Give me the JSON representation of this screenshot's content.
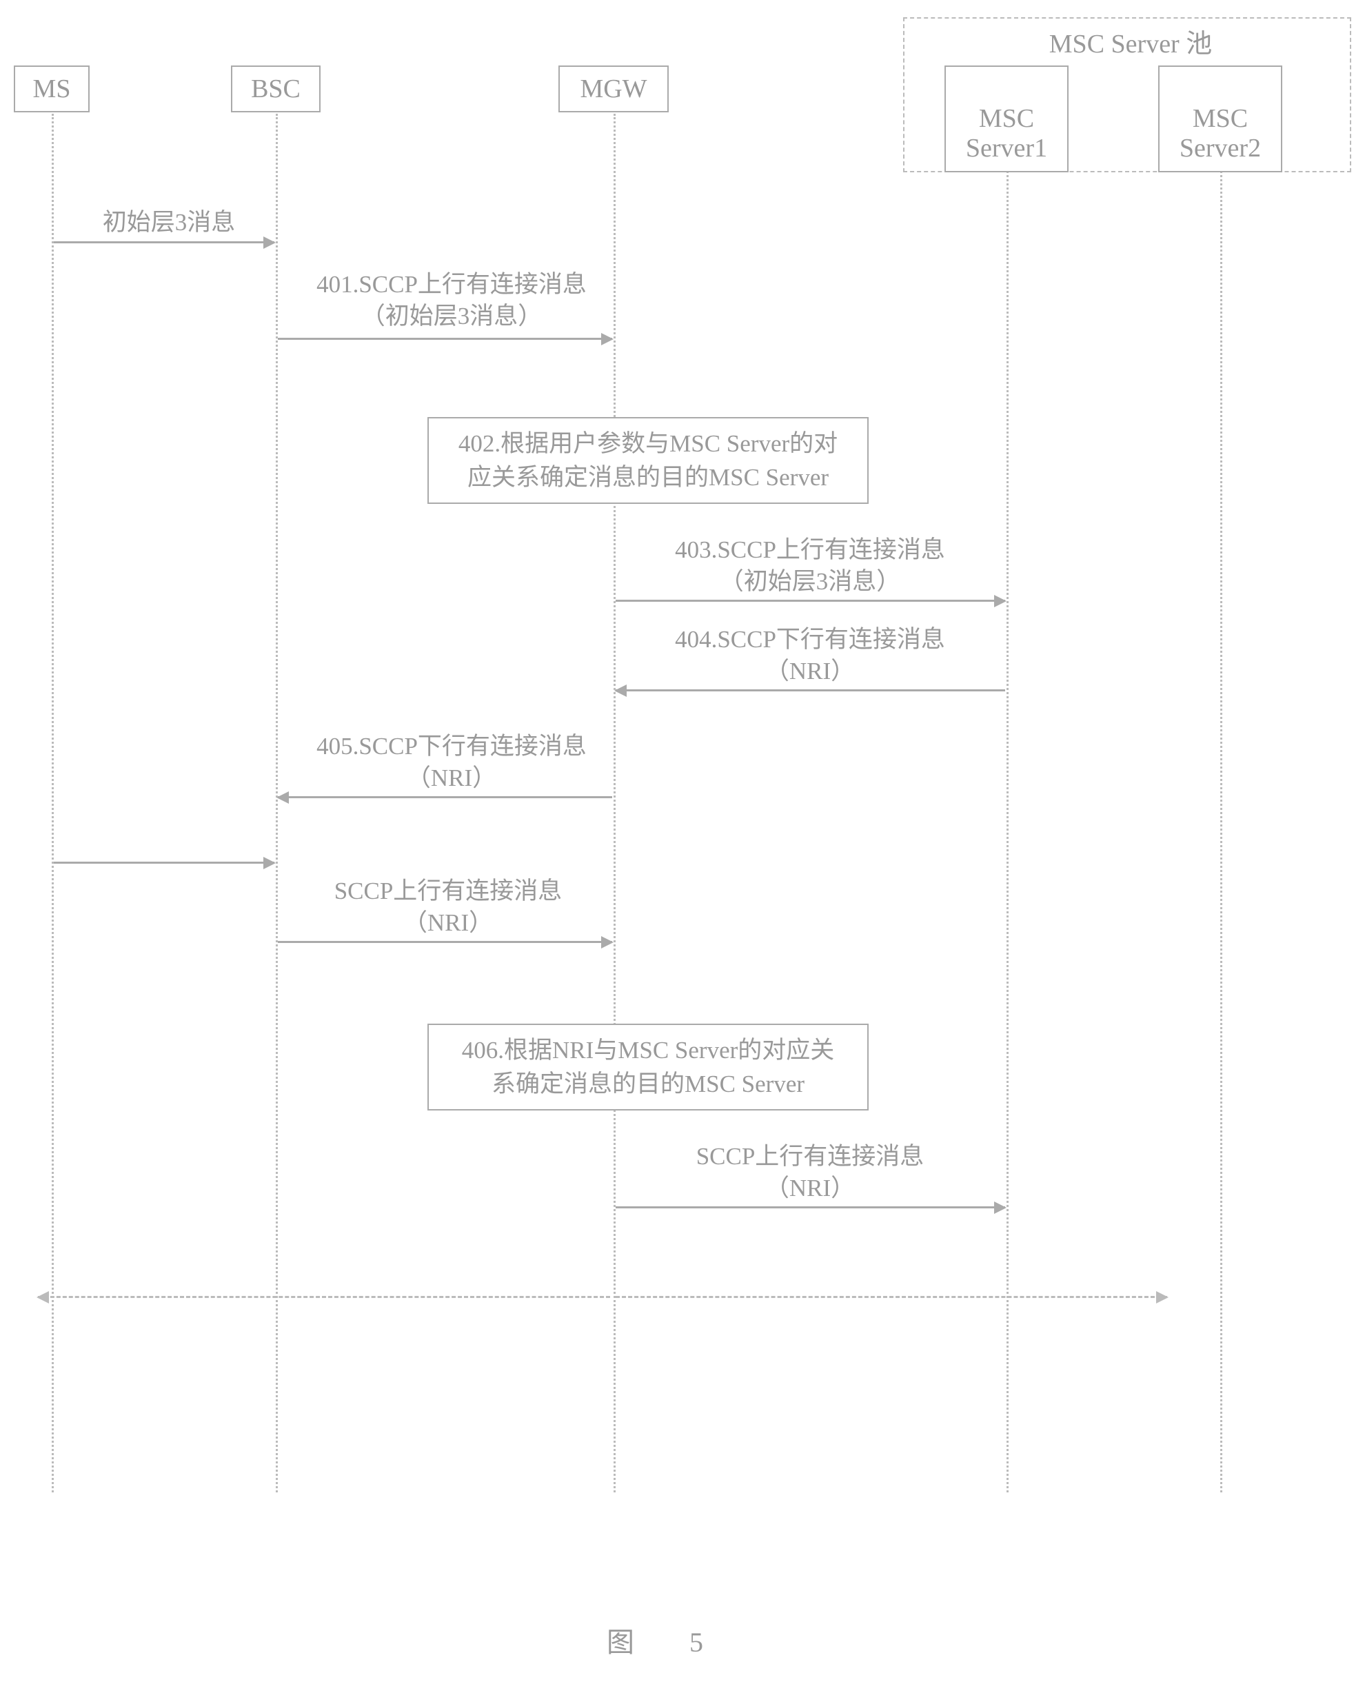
{
  "participants": {
    "ms": "MS",
    "bsc": "BSC",
    "mgw": "MGW",
    "msc1": "MSC\nServer1",
    "msc2": "MSC\nServer2"
  },
  "pool_label": "MSC Server 池",
  "messages": {
    "init_l3": "初始层3消息",
    "m401_line1": "401.SCCP上行有连接消息",
    "m401_line2": "（初始层3消息）",
    "m402_line1": "402.根据用户参数与MSC Server的对",
    "m402_line2": "应关系确定消息的目的MSC Server",
    "m403_line1": "403.SCCP上行有连接消息",
    "m403_line2": "（初始层3消息）",
    "m404_line1": "404.SCCP下行有连接消息",
    "m404_line2": "（NRI）",
    "m405_line1": "405.SCCP下行有连接消息",
    "m405_line2": "（NRI）",
    "up_nri_line1": "SCCP上行有连接消息",
    "up_nri_line2": "（NRI）",
    "m406_line1": "406.根据NRI与MSC Server的对应关",
    "m406_line2": "系确定消息的目的MSC Server",
    "up_nri2_line1": "SCCP上行有连接消息",
    "up_nri2_line2": "（NRI）"
  },
  "figure_label": "图　5"
}
